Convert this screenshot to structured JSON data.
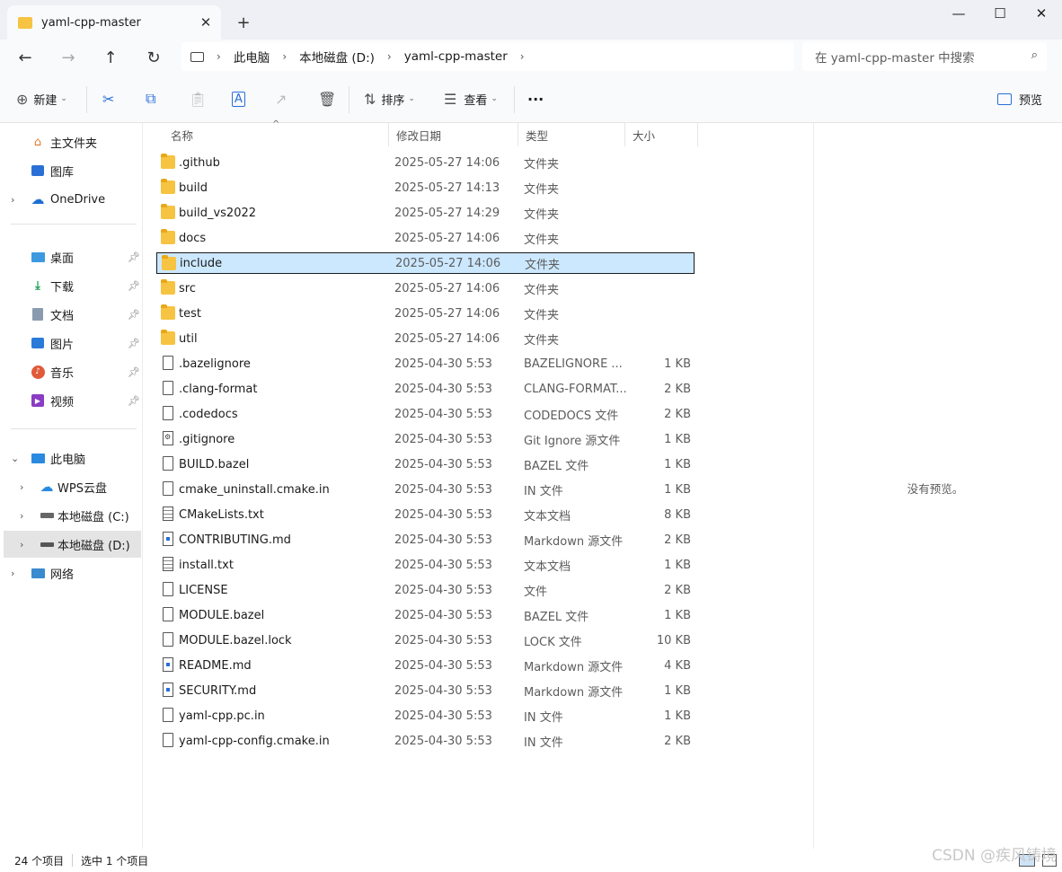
{
  "window": {
    "tab_title": "yaml-cpp-master",
    "new_tab": "+",
    "close_tab": "✕",
    "minimize": "—",
    "maximize": "☐",
    "close": "✕"
  },
  "nav": {
    "back": "←",
    "forward": "→",
    "up": "↑",
    "refresh": "↻",
    "breadcrumb": [
      "此电脑",
      "本地磁盘 (D:)",
      "yaml-cpp-master"
    ],
    "search_placeholder": "在 yaml-cpp-master 中搜索"
  },
  "toolbar": {
    "new_label": "新建",
    "sort_label": "排序",
    "view_label": "查看",
    "more": "···",
    "preview_label": "预览"
  },
  "sidebar": {
    "quick": [
      {
        "label": "主文件夹",
        "icon": "home-icon"
      },
      {
        "label": "图库",
        "icon": "gallery-icon"
      },
      {
        "label": "OneDrive",
        "icon": "onedrive-icon"
      }
    ],
    "pinned": [
      {
        "label": "桌面",
        "icon": "desktop-icon"
      },
      {
        "label": "下载",
        "icon": "download-icon"
      },
      {
        "label": "文档",
        "icon": "documents-icon"
      },
      {
        "label": "图片",
        "icon": "pictures-icon"
      },
      {
        "label": "音乐",
        "icon": "music-icon"
      },
      {
        "label": "视频",
        "icon": "video-icon"
      }
    ],
    "this_pc": "此电脑",
    "drives": [
      {
        "label": "WPS云盘",
        "icon": "cloud-icon"
      },
      {
        "label": "本地磁盘 (C:)",
        "icon": "drive-icon"
      },
      {
        "label": "本地磁盘 (D:)",
        "icon": "drive-icon"
      }
    ],
    "network": "网络"
  },
  "columns": {
    "name": "名称",
    "date": "修改日期",
    "type": "类型",
    "size": "大小"
  },
  "files": [
    {
      "name": ".github",
      "date": "2025-05-27 14:06",
      "type": "文件夹",
      "size": "",
      "kind": "folder"
    },
    {
      "name": "build",
      "date": "2025-05-27 14:13",
      "type": "文件夹",
      "size": "",
      "kind": "folder"
    },
    {
      "name": "build_vs2022",
      "date": "2025-05-27 14:29",
      "type": "文件夹",
      "size": "",
      "kind": "folder"
    },
    {
      "name": "docs",
      "date": "2025-05-27 14:06",
      "type": "文件夹",
      "size": "",
      "kind": "folder"
    },
    {
      "name": "include",
      "date": "2025-05-27 14:06",
      "type": "文件夹",
      "size": "",
      "kind": "folder",
      "selected": true
    },
    {
      "name": "src",
      "date": "2025-05-27 14:06",
      "type": "文件夹",
      "size": "",
      "kind": "folder"
    },
    {
      "name": "test",
      "date": "2025-05-27 14:06",
      "type": "文件夹",
      "size": "",
      "kind": "folder"
    },
    {
      "name": "util",
      "date": "2025-05-27 14:06",
      "type": "文件夹",
      "size": "",
      "kind": "folder"
    },
    {
      "name": ".bazelignore",
      "date": "2025-04-30 5:53",
      "type": "BAZELIGNORE ...",
      "size": "1 KB",
      "kind": "doc"
    },
    {
      "name": ".clang-format",
      "date": "2025-04-30 5:53",
      "type": "CLANG-FORMAT...",
      "size": "2 KB",
      "kind": "doc"
    },
    {
      "name": ".codedocs",
      "date": "2025-04-30 5:53",
      "type": "CODEDOCS 文件",
      "size": "2 KB",
      "kind": "doc"
    },
    {
      "name": ".gitignore",
      "date": "2025-04-30 5:53",
      "type": "Git Ignore 源文件",
      "size": "1 KB",
      "kind": "git"
    },
    {
      "name": "BUILD.bazel",
      "date": "2025-04-30 5:53",
      "type": "BAZEL 文件",
      "size": "1 KB",
      "kind": "doc"
    },
    {
      "name": "cmake_uninstall.cmake.in",
      "date": "2025-04-30 5:53",
      "type": "IN 文件",
      "size": "1 KB",
      "kind": "doc"
    },
    {
      "name": "CMakeLists.txt",
      "date": "2025-04-30 5:53",
      "type": "文本文档",
      "size": "8 KB",
      "kind": "txt"
    },
    {
      "name": "CONTRIBUTING.md",
      "date": "2025-04-30 5:53",
      "type": "Markdown 源文件",
      "size": "2 KB",
      "kind": "md"
    },
    {
      "name": "install.txt",
      "date": "2025-04-30 5:53",
      "type": "文本文档",
      "size": "1 KB",
      "kind": "txt"
    },
    {
      "name": "LICENSE",
      "date": "2025-04-30 5:53",
      "type": "文件",
      "size": "2 KB",
      "kind": "doc"
    },
    {
      "name": "MODULE.bazel",
      "date": "2025-04-30 5:53",
      "type": "BAZEL 文件",
      "size": "1 KB",
      "kind": "doc"
    },
    {
      "name": "MODULE.bazel.lock",
      "date": "2025-04-30 5:53",
      "type": "LOCK 文件",
      "size": "10 KB",
      "kind": "doc"
    },
    {
      "name": "README.md",
      "date": "2025-04-30 5:53",
      "type": "Markdown 源文件",
      "size": "4 KB",
      "kind": "md"
    },
    {
      "name": "SECURITY.md",
      "date": "2025-04-30 5:53",
      "type": "Markdown 源文件",
      "size": "1 KB",
      "kind": "md"
    },
    {
      "name": "yaml-cpp.pc.in",
      "date": "2025-04-30 5:53",
      "type": "IN 文件",
      "size": "1 KB",
      "kind": "doc"
    },
    {
      "name": "yaml-cpp-config.cmake.in",
      "date": "2025-04-30 5:53",
      "type": "IN 文件",
      "size": "2 KB",
      "kind": "doc"
    }
  ],
  "preview_pane": {
    "text": "没有预览。"
  },
  "status": {
    "count": "24 个项目",
    "selected": "选中 1 个项目"
  },
  "watermark": "CSDN @疾风铸境"
}
